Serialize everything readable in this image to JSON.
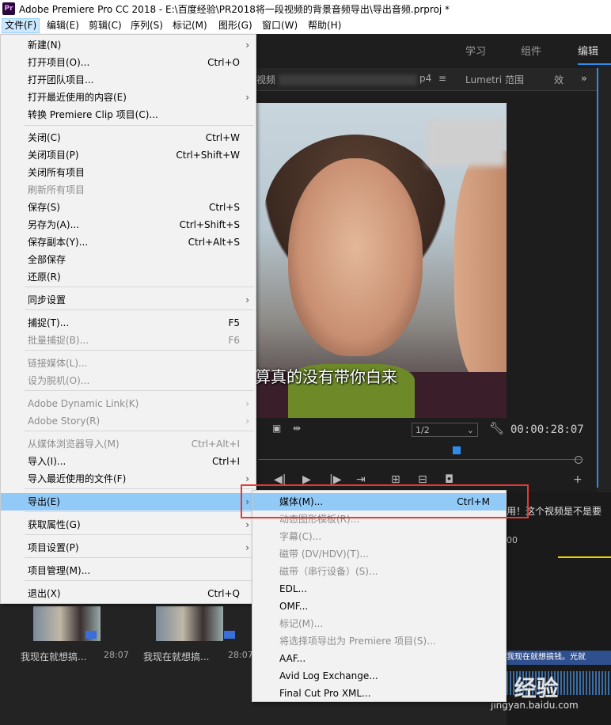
{
  "window": {
    "logo": "Pr",
    "title": "Adobe Premiere Pro CC 2018 - E:\\百度经验\\PR2018将一段视频的背景音频导出\\导出音频.prproj *"
  },
  "menubar": [
    "文件(F)",
    "编辑(E)",
    "剪辑(C)",
    "序列(S)",
    "标记(M)",
    "图形(G)",
    "窗口(W)",
    "帮助(H)"
  ],
  "workspaces": [
    "学习",
    "组件",
    "编辑"
  ],
  "monitor": {
    "tab_prefix": "视频",
    "tab_suffix": "p4",
    "lumetri_tab": "Lumetri 范围",
    "effects_tab_fragment": "效",
    "more_icon": "»",
    "subtitle": "算真的没有带你白来",
    "fit_value": "1/2",
    "timecode": "00:00:28:07"
  },
  "sequence": {
    "caption_text": "用！这个视频是不是要",
    "time_label": "00",
    "clip_text": "我现在就想搞钱。光就"
  },
  "project": {
    "clips": [
      {
        "name": "我现在就想搞...",
        "duration": "28:07"
      },
      {
        "name": "我现在就想搞...",
        "duration": "28:07"
      }
    ]
  },
  "file_menu": [
    {
      "label": "新建(N)",
      "shortcut": "",
      "submenu": true,
      "disabled": false
    },
    {
      "label": "打开项目(O)...",
      "shortcut": "Ctrl+O",
      "submenu": false,
      "disabled": false
    },
    {
      "label": "打开团队项目...",
      "shortcut": "",
      "submenu": false,
      "disabled": false
    },
    {
      "label": "打开最近使用的内容(E)",
      "shortcut": "",
      "submenu": true,
      "disabled": false
    },
    {
      "label": "转换 Premiere Clip 项目(C)...",
      "shortcut": "",
      "submenu": false,
      "disabled": false
    },
    {
      "label": "关闭(C)",
      "shortcut": "Ctrl+W",
      "submenu": false,
      "disabled": false
    },
    {
      "label": "关闭项目(P)",
      "shortcut": "Ctrl+Shift+W",
      "submenu": false,
      "disabled": false
    },
    {
      "label": "关闭所有项目",
      "shortcut": "",
      "submenu": false,
      "disabled": false
    },
    {
      "label": "刷新所有项目",
      "shortcut": "",
      "submenu": false,
      "disabled": true
    },
    {
      "label": "保存(S)",
      "shortcut": "Ctrl+S",
      "submenu": false,
      "disabled": false
    },
    {
      "label": "另存为(A)...",
      "shortcut": "Ctrl+Shift+S",
      "submenu": false,
      "disabled": false
    },
    {
      "label": "保存副本(Y)...",
      "shortcut": "Ctrl+Alt+S",
      "submenu": false,
      "disabled": false
    },
    {
      "label": "全部保存",
      "shortcut": "",
      "submenu": false,
      "disabled": false
    },
    {
      "label": "还原(R)",
      "shortcut": "",
      "submenu": false,
      "disabled": false
    },
    {
      "label": "同步设置",
      "shortcut": "",
      "submenu": true,
      "disabled": false
    },
    {
      "label": "捕捉(T)...",
      "shortcut": "F5",
      "submenu": false,
      "disabled": false
    },
    {
      "label": "批量捕捉(B)...",
      "shortcut": "F6",
      "submenu": false,
      "disabled": true
    },
    {
      "label": "链接媒体(L)...",
      "shortcut": "",
      "submenu": false,
      "disabled": true
    },
    {
      "label": "设为脱机(O)...",
      "shortcut": "",
      "submenu": false,
      "disabled": true
    },
    {
      "label": "Adobe Dynamic Link(K)",
      "shortcut": "",
      "submenu": true,
      "disabled": true
    },
    {
      "label": "Adobe Story(R)",
      "shortcut": "",
      "submenu": true,
      "disabled": true
    },
    {
      "label": "从媒体浏览器导入(M)",
      "shortcut": "Ctrl+Alt+I",
      "submenu": false,
      "disabled": true
    },
    {
      "label": "导入(I)...",
      "shortcut": "Ctrl+I",
      "submenu": false,
      "disabled": false
    },
    {
      "label": "导入最近使用的文件(F)",
      "shortcut": "",
      "submenu": true,
      "disabled": false
    },
    {
      "label": "导出(E)",
      "shortcut": "",
      "submenu": true,
      "disabled": false,
      "highlighted": true
    },
    {
      "label": "获取属性(G)",
      "shortcut": "",
      "submenu": true,
      "disabled": false
    },
    {
      "label": "项目设置(P)",
      "shortcut": "",
      "submenu": true,
      "disabled": false
    },
    {
      "label": "项目管理(M)...",
      "shortcut": "",
      "submenu": false,
      "disabled": false
    },
    {
      "label": "退出(X)",
      "shortcut": "Ctrl+Q",
      "submenu": false,
      "disabled": false
    }
  ],
  "export_submenu": [
    {
      "label": "媒体(M)...",
      "shortcut": "Ctrl+M",
      "disabled": false,
      "highlighted": true
    },
    {
      "label": "动态图形模板(R)...",
      "shortcut": "",
      "disabled": true
    },
    {
      "label": "字幕(C)...",
      "shortcut": "",
      "disabled": true
    },
    {
      "label": "磁带 (DV/HDV)(T)...",
      "shortcut": "",
      "disabled": true
    },
    {
      "label": "磁带（串行设备）(S)...",
      "shortcut": "",
      "disabled": true
    },
    {
      "label": "EDL...",
      "shortcut": "",
      "disabled": false
    },
    {
      "label": "OMF...",
      "shortcut": "",
      "disabled": false
    },
    {
      "label": "标记(M)...",
      "shortcut": "",
      "disabled": true
    },
    {
      "label": "将选择项导出为 Premiere 项目(S)...",
      "shortcut": "",
      "disabled": true
    },
    {
      "label": "AAF...",
      "shortcut": "",
      "disabled": false
    },
    {
      "label": "Avid Log Exchange...",
      "shortcut": "",
      "disabled": false
    },
    {
      "label": "Final Cut Pro XML...",
      "shortcut": "",
      "disabled": false
    }
  ],
  "watermark": {
    "text": "Bai 经验",
    "url": "jingyan.baidu.com"
  }
}
